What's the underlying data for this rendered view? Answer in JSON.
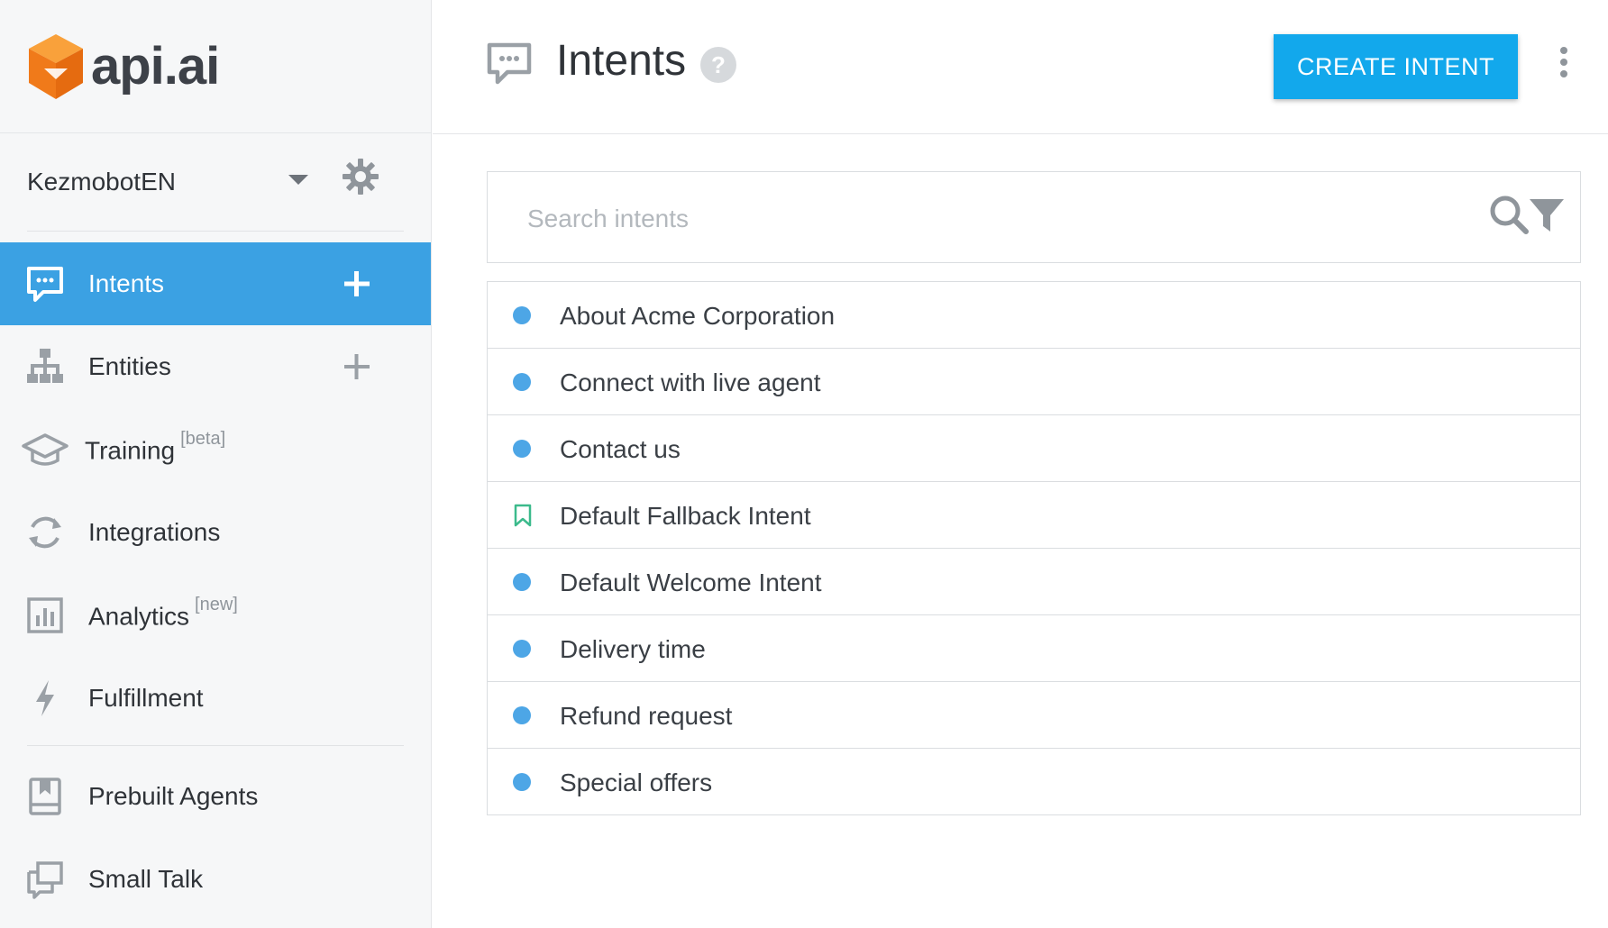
{
  "brand": {
    "name": "api.ai",
    "logo_color": "#f7811f"
  },
  "agent": {
    "name": "KezmobotEN"
  },
  "sidebar": {
    "accent": "#3ba1e3",
    "items": [
      {
        "label": "Intents",
        "sup": "",
        "icon": "chat-icon",
        "active": true,
        "plus": true
      },
      {
        "label": "Entities",
        "sup": "",
        "icon": "hierarchy-icon",
        "active": false,
        "plus": true
      },
      {
        "label": "Training",
        "sup": "[beta]",
        "icon": "graduation-cap-icon",
        "active": false,
        "plus": false
      },
      {
        "label": "Integrations",
        "sup": "",
        "icon": "sync-icon",
        "active": false,
        "plus": false
      },
      {
        "label": "Analytics",
        "sup": "[new]",
        "icon": "bar-chart-icon",
        "active": false,
        "plus": false
      },
      {
        "label": "Fulfillment",
        "sup": "",
        "icon": "lightning-icon",
        "active": false,
        "plus": false
      }
    ],
    "bottom_items": [
      {
        "label": "Prebuilt Agents",
        "icon": "book-icon"
      },
      {
        "label": "Small Talk",
        "icon": "chat-windows-icon"
      }
    ]
  },
  "header": {
    "title": "Intents",
    "create_button_label": "CREATE INTENT",
    "button_color": "#12a8ec"
  },
  "search": {
    "placeholder": "Search intents",
    "value": ""
  },
  "intents": [
    {
      "name": "About Acme Corporation",
      "marker": "dot"
    },
    {
      "name": "Connect with live agent",
      "marker": "dot"
    },
    {
      "name": "Contact us",
      "marker": "dot"
    },
    {
      "name": "Default Fallback Intent",
      "marker": "bookmark"
    },
    {
      "name": "Default Welcome Intent",
      "marker": "dot"
    },
    {
      "name": "Delivery time",
      "marker": "dot"
    },
    {
      "name": "Refund request",
      "marker": "dot"
    },
    {
      "name": "Special offers",
      "marker": "dot"
    }
  ]
}
